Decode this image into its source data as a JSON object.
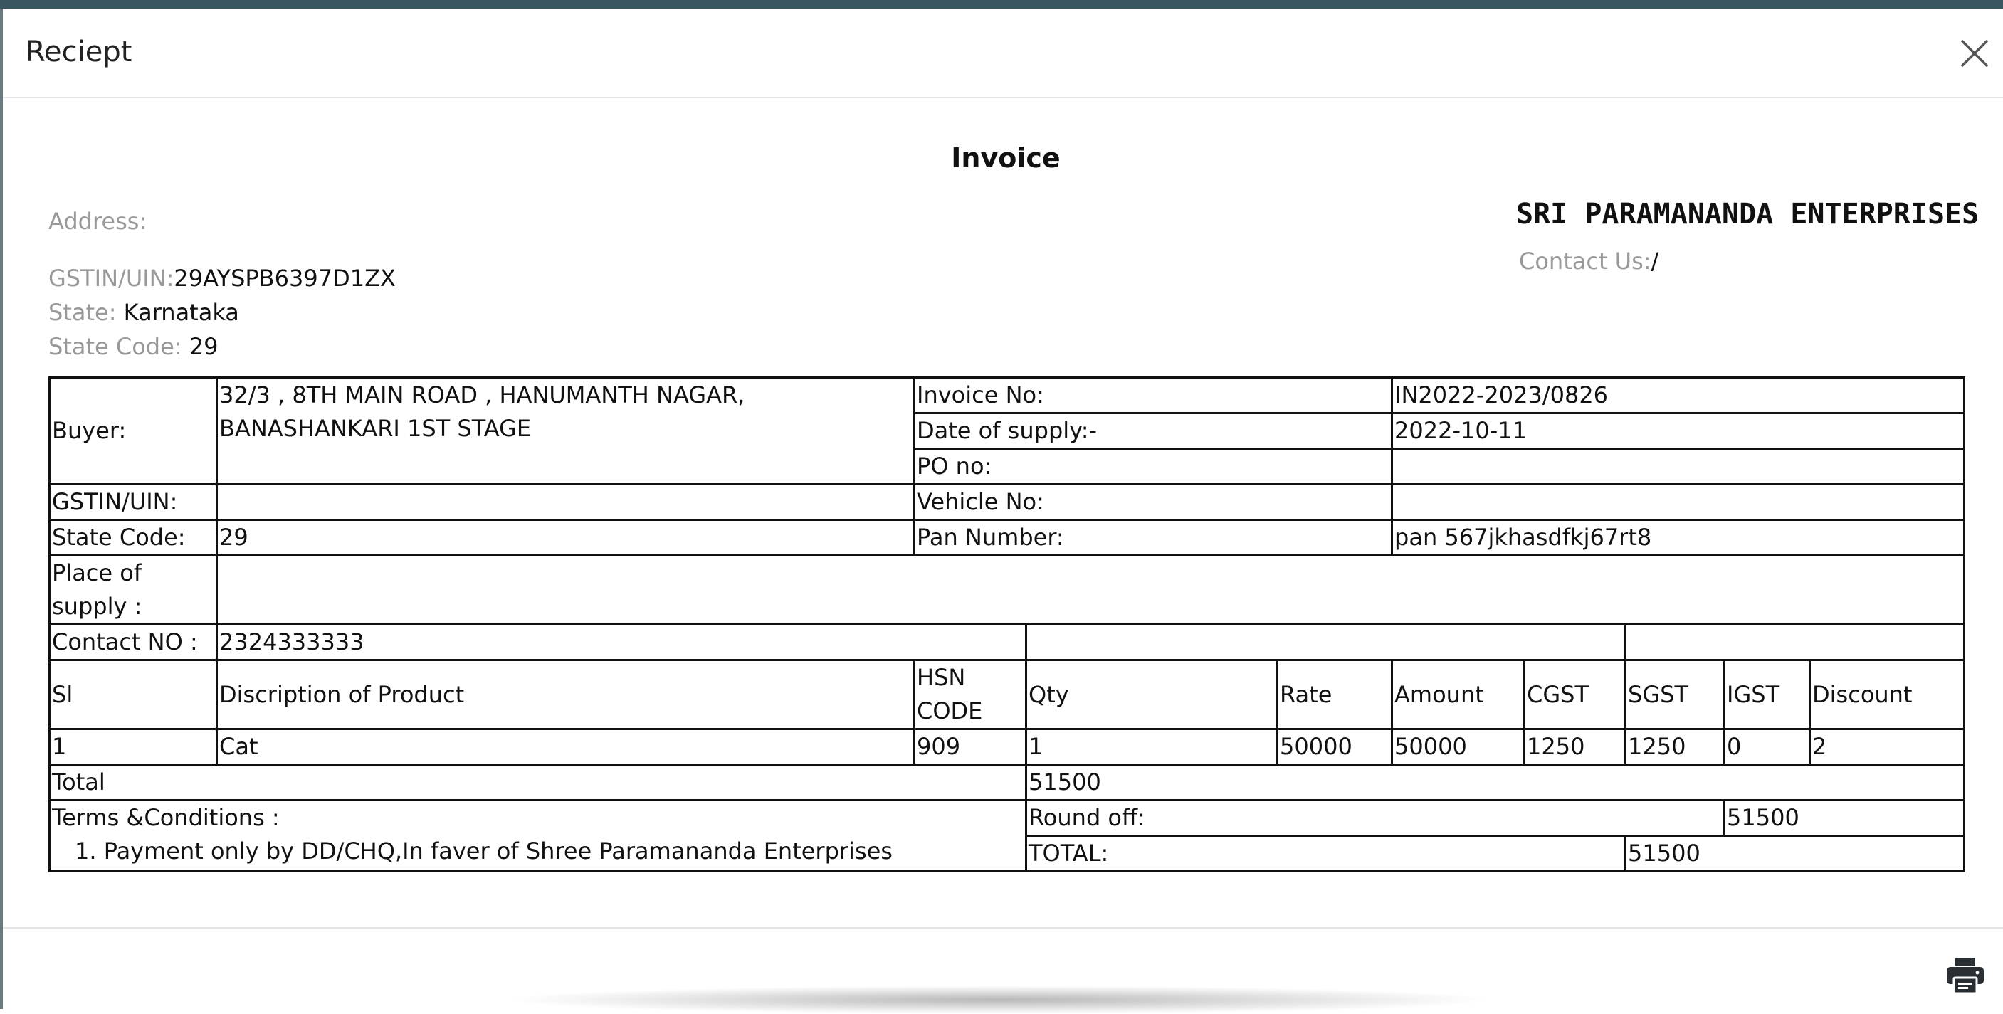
{
  "modal": {
    "title": "Reciept"
  },
  "invoice": {
    "heading": "Invoice",
    "address_label": "Address:",
    "address_value": "",
    "gstin_label": "GSTIN/UIN:",
    "gstin_value": "29AYSPB6397D1ZX",
    "state_label": "State:",
    "state_value": "Karnataka",
    "state_code_label": "State Code:",
    "state_code_value": "29",
    "company_name": "SRI PARAMANANDA ENTERPRISES",
    "contact_label": "Contact Us:",
    "contact_value": "/"
  },
  "table": {
    "buyer_label": "Buyer:",
    "buyer_address": "32/3 , 8TH MAIN ROAD , HANUMANTH NAGAR, BANASHANKARI 1ST STAGE",
    "invoice_no_label": "Invoice No:",
    "invoice_no": "IN2022-2023/0826",
    "date_label": "Date of supply:-",
    "date": "2022-10-11",
    "po_label": "PO no:",
    "po": "",
    "gstin_label": "GSTIN/UIN:",
    "gstin": "",
    "vehicle_label": "Vehicle No:",
    "vehicle": "",
    "state_code_label": "State Code:",
    "state_code": "29",
    "pan_label": "Pan Number:",
    "pan": "pan 567jkhasdfkj67rt8",
    "place_label": "Place of supply :",
    "place": "",
    "contact_label": "Contact NO :",
    "contact": "2324333333",
    "headers": [
      "Sl",
      "Discription of Product",
      "HSN CODE",
      "Qty",
      "Rate",
      "Amount",
      "CGST",
      "SGST",
      "IGST",
      "Discount"
    ],
    "rows": [
      {
        "sl": "1",
        "product": "Cat",
        "hsn": "909",
        "qty": "1",
        "rate": "50000",
        "amount": "50000",
        "cgst": "1250",
        "sgst": "1250",
        "igst": "0",
        "discount": "2"
      }
    ],
    "total_label": "Total",
    "total": "51500",
    "terms_label": "Terms &Conditions :",
    "terms": [
      "1. Payment only by DD/CHQ,In faver of Shree Paramananda Enterprises"
    ],
    "roundoff_label": "Round off:",
    "roundoff": "51500",
    "grand_total_label": "TOTAL:",
    "grand_total": "51500"
  },
  "footer": {
    "print_icon": "printer-icon"
  },
  "colors": {
    "topbar": "#3a5560",
    "border": "#111111",
    "muted": "#999999"
  }
}
